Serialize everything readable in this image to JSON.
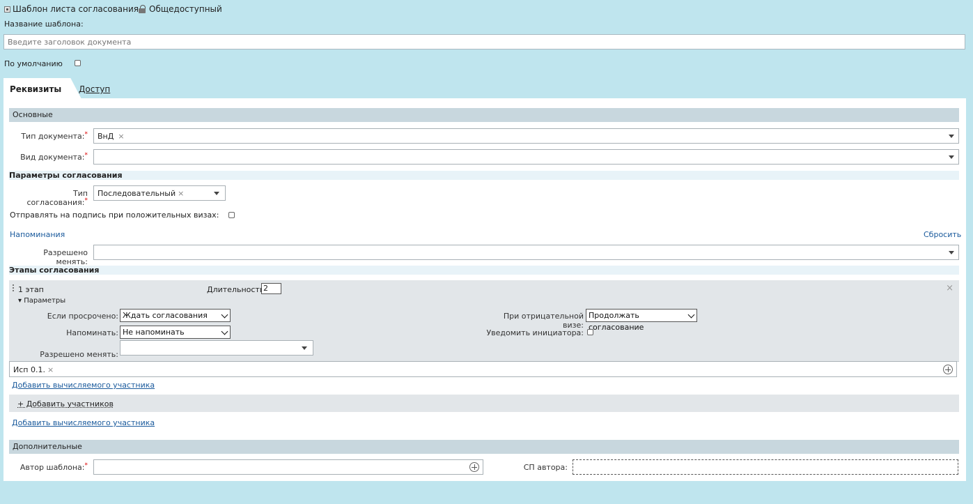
{
  "header": {
    "template_label": "Шаблон листа согласования",
    "public_label": "Общедоступный",
    "name_label": "Название шаблона:",
    "name_placeholder": "Введите заголовок документа",
    "default_label": "По умолчанию"
  },
  "tabs": [
    {
      "label": "Реквизиты"
    },
    {
      "label": "Доступ"
    }
  ],
  "basic": {
    "section_title": "Основные",
    "doc_type_label": "Тип документа:",
    "doc_type_value": "ВнД",
    "doc_kind_label": "Вид документа:",
    "required_mark": "*"
  },
  "approval_params": {
    "title": "Параметры согласования",
    "type_label": "Тип согласования:",
    "type_value": "Последовательный",
    "send_sign_label": "Отправлять на подпись при положительных визах:",
    "reminders_link": "Напоминания",
    "reset_link": "Сбросить",
    "allowed_change_label": "Разрешено менять:"
  },
  "stages": {
    "title": "Этапы согласования",
    "stage_name": "1 этап",
    "duration_label": "Длительность:",
    "duration_value": "2",
    "params_toggle": "▾ Параметры",
    "overdue_label": "Если просрочено:",
    "overdue_value": "Ждать согласования",
    "remind_label": "Напоминать:",
    "remind_value": "Не напоминать",
    "allowed_change_label": "Разрешено менять:",
    "negative_visa_label": "При отрицательной визе:",
    "negative_visa_value": "Продолжать согласование",
    "notify_initiator_label": "Уведомить инициатора:",
    "participant": "Исп 0.1.",
    "add_computed_1": "Добавить вычисляемого участника",
    "add_participants": "+ Добавить участников",
    "add_computed_2": "Добавить вычисляемого участника"
  },
  "additional": {
    "section_title": "Дополнительные",
    "author_label": "Автор шаблона:",
    "author_dept_label": "СП автора:"
  },
  "icons": {
    "remove": "×"
  }
}
